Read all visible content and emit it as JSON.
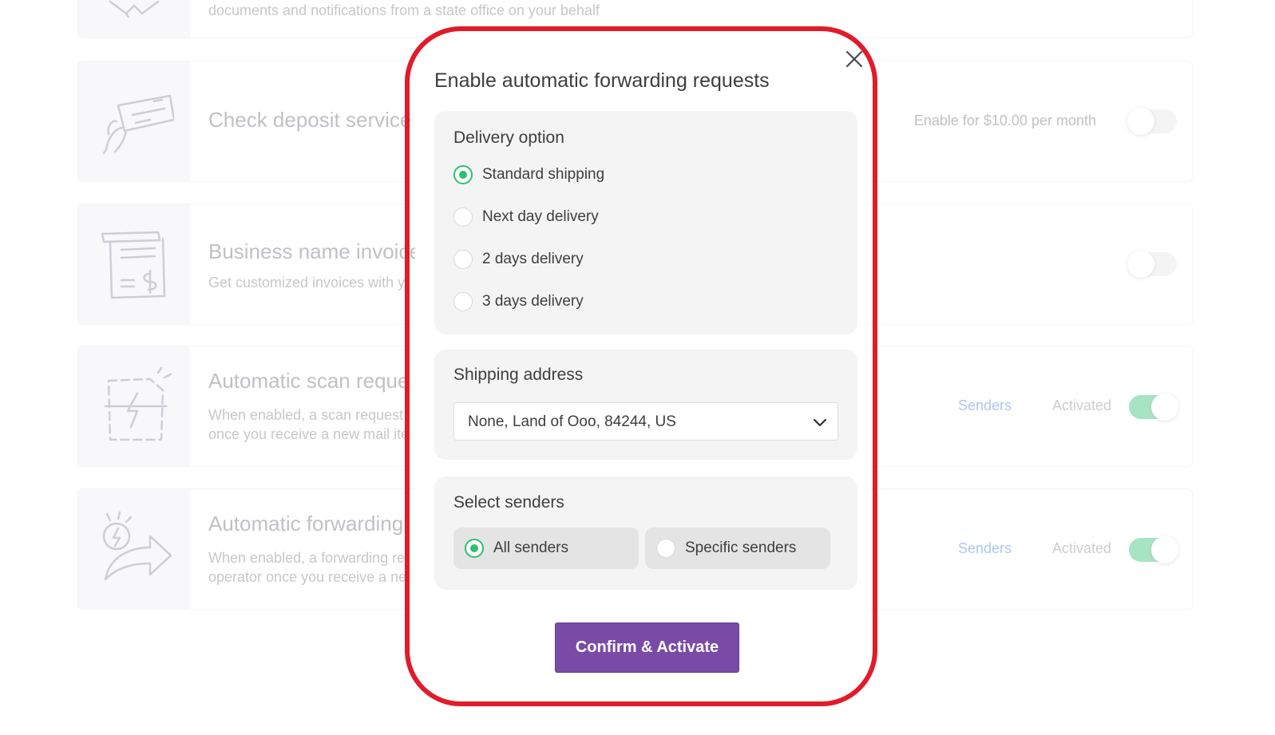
{
  "background": {
    "top_card": {
      "description": "documents and notifications from a state office on your behalf"
    },
    "check_deposit": {
      "title": "Check deposit service",
      "price_label": "Enable for $10.00 per month"
    },
    "business_invoices": {
      "title": "Business name invoice",
      "description": "Get customized invoices with y"
    },
    "auto_scan": {
      "title": "Automatic scan reque",
      "description_line1": "When enabled, a scan request",
      "description_line2": "once you receive a new mail ite",
      "senders_link": "Senders",
      "status": "Activated"
    },
    "auto_forward": {
      "title": "Automatic forwarding",
      "description_line1": "When enabled, a forwarding re",
      "description_line2": "operator once you receive a ne",
      "senders_link": "Senders",
      "status": "Activated"
    }
  },
  "modal": {
    "title": "Enable automatic forwarding requests",
    "delivery": {
      "title": "Delivery option",
      "options": [
        {
          "label": "Standard shipping",
          "selected": true
        },
        {
          "label": "Next day delivery",
          "selected": false
        },
        {
          "label": "2 days delivery",
          "selected": false
        },
        {
          "label": "3 days delivery",
          "selected": false
        }
      ]
    },
    "shipping": {
      "title": "Shipping address",
      "selected_address": "None, Land of Ooo, 84244, US"
    },
    "senders": {
      "title": "Select senders",
      "options": [
        {
          "label": "All senders",
          "selected": true
        },
        {
          "label": "Specific senders",
          "selected": false
        }
      ]
    },
    "confirm_label": "Confirm & Activate"
  },
  "colors": {
    "accent_purple": "#7a4ba6",
    "success_green": "#2fbf71",
    "highlight_red": "#e11b2a",
    "link_blue": "#3b7be0"
  }
}
